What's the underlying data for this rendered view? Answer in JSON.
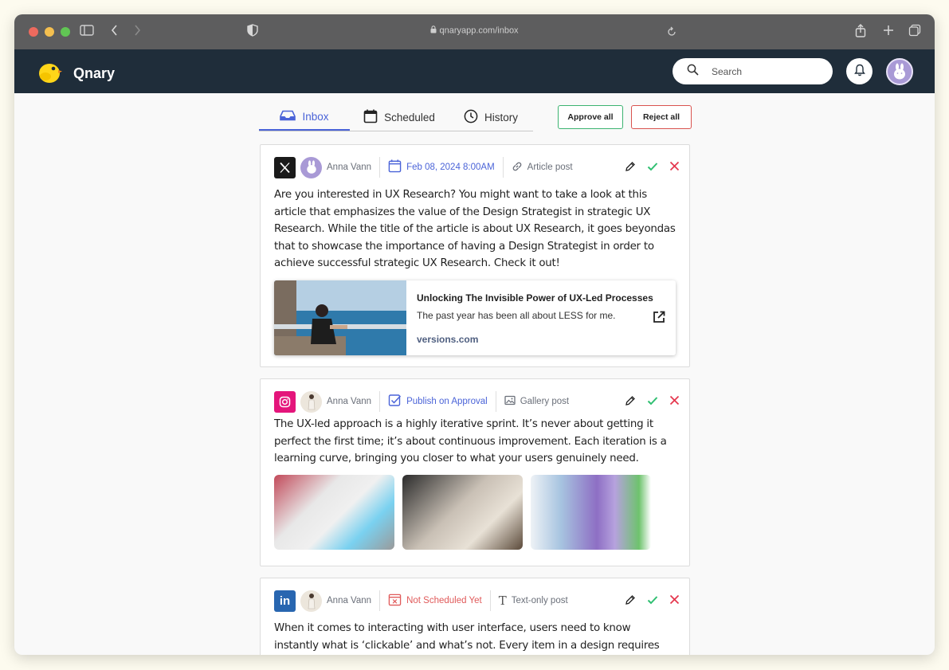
{
  "browser": {
    "url": "qnaryapp.com/inbox"
  },
  "app": {
    "brand": "Qnary",
    "search_placeholder": "Search"
  },
  "tabs": [
    {
      "label": "Inbox",
      "active": true
    },
    {
      "label": "Scheduled",
      "active": false
    },
    {
      "label": "History",
      "active": false
    }
  ],
  "bulk_actions": {
    "approve_all": "Approve all",
    "reject_all": "Reject all"
  },
  "posts": [
    {
      "network": "x",
      "author": "Anna Vann",
      "schedule": "Feb 08, 2024  8:00AM",
      "post_type": "Article post",
      "body": "Are you interested in UX Research? You might want to take a look at this article that emphasizes the value of the Design Strategist in strategic UX Research. While the title of the article is about UX Research, it goes beyondas that to showcase the importance of having a Design Strategist in order to achieve successful strategic UX Research. Check it out!",
      "link": {
        "title": "Unlocking The Invisible Power of UX-Led Processes",
        "description": "The past year has been all about LESS for me.",
        "domain": "versions.com"
      }
    },
    {
      "network": "instagram",
      "author": "Anna Vann",
      "schedule": "Publish on Approval",
      "post_type": "Gallery post",
      "body": "The UX-led approach is a highly iterative sprint. It’s never about getting it perfect the first time; it’s about continuous improvement. Each iteration is a learning curve, bringing you closer to what your users genuinely need."
    },
    {
      "network": "linkedin",
      "author": "Anna Vann",
      "schedule": "Not Scheduled Yet",
      "post_type": "Text-only post",
      "body": "When it comes to interacting with user interface, users need to know instantly what is ‘clickable’ and what’s not. Every item in a design requires effort by the"
    }
  ],
  "colors": {
    "accent": "#4a63d8",
    "header_bg": "#1f2d3a",
    "approve": "#3cb371",
    "reject": "#d9534f",
    "instagram": "#e4157b",
    "linkedin": "#2866b0"
  }
}
